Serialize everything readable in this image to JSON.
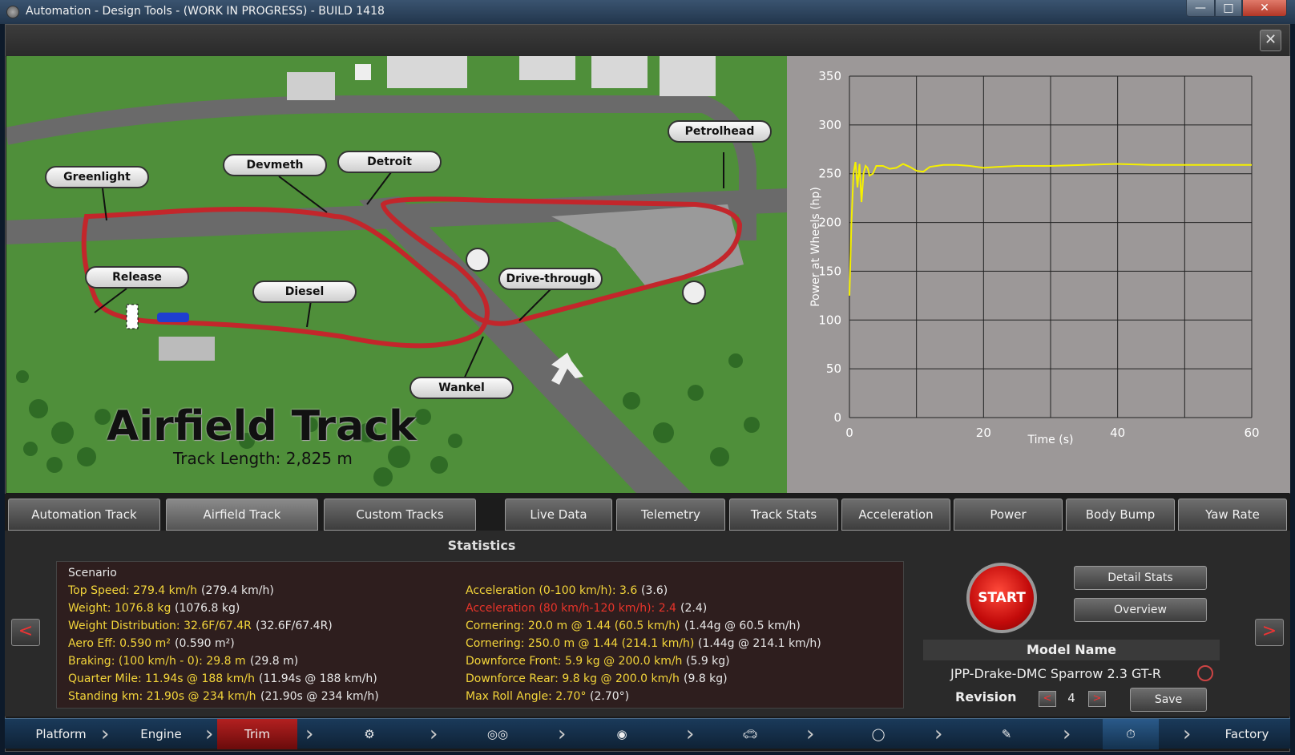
{
  "window": {
    "title": "Automation - Design Tools - (WORK IN PROGRESS) - BUILD 1418"
  },
  "map": {
    "title": "Airfield Track",
    "length": "Track Length: 2,825 m",
    "labels": {
      "greenlight": "Greenlight",
      "devmeth": "Devmeth",
      "detroit": "Detroit",
      "petrolhead": "Petrolhead",
      "release": "Release",
      "diesel": "Diesel",
      "drive_through": "Drive-through",
      "wankel": "Wankel"
    }
  },
  "chart_data": {
    "type": "line",
    "xlabel": "Time (s)",
    "ylabel": "Power at Wheels (hp)",
    "xlim": [
      0,
      60
    ],
    "ylim": [
      0,
      350
    ],
    "xticks": [
      "0",
      "20",
      "40",
      "60"
    ],
    "yticks": [
      "0",
      "50",
      "100",
      "150",
      "200",
      "250",
      "300",
      "350"
    ],
    "line_color": "#f5f000",
    "grid": true,
    "x": [
      0,
      0.3,
      0.6,
      0.9,
      1.2,
      1.5,
      1.8,
      2.1,
      2.4,
      2.7,
      3.0,
      3.5,
      4,
      5,
      6,
      7,
      8,
      9,
      10,
      11,
      12,
      14,
      16,
      18,
      20,
      22,
      25,
      30,
      35,
      40,
      45,
      50,
      55,
      60
    ],
    "y": [
      125,
      200,
      250,
      262,
      236,
      260,
      221,
      250,
      258,
      256,
      248,
      250,
      258,
      258,
      255,
      256,
      260,
      257,
      253,
      252,
      257,
      259,
      259,
      258,
      256,
      257,
      258,
      258,
      259,
      260,
      259,
      259,
      259,
      259
    ]
  },
  "tabs": {
    "automation_track": "Automation Track",
    "airfield_track": "Airfield Track",
    "custom_tracks": "Custom Tracks",
    "live_data": "Live Data",
    "telemetry": "Telemetry",
    "track_stats": "Track Stats",
    "acceleration": "Acceleration",
    "power": "Power",
    "body_bump": "Body Bump",
    "yaw_rate": "Yaw Rate"
  },
  "stats": {
    "header": "Statistics",
    "scenario": "Scenario",
    "left": [
      {
        "label": "Top Speed: 279.4 km/h",
        "value": "(279.4 km/h)"
      },
      {
        "label": "Weight: 1076.8 kg",
        "value": "(1076.8 kg)"
      },
      {
        "label": "Weight Distribution: 32.6F/67.4R",
        "value": "(32.6F/67.4R)"
      },
      {
        "label": "Aero Eff: 0.590 m²",
        "value": "(0.590 m²)"
      },
      {
        "label": "Braking: (100 km/h - 0): 29.8 m",
        "value": "(29.8 m)"
      },
      {
        "label": "Quarter Mile: 11.94s @ 188 km/h",
        "value": "(11.94s @ 188 km/h)"
      },
      {
        "label": "Standing km: 21.90s @ 234 km/h",
        "value": "(21.90s @ 234 km/h)"
      }
    ],
    "right": [
      {
        "label": "Acceleration (0-100 km/h): 3.6",
        "value": "(3.6)"
      },
      {
        "label": "Acceleration (80 km/h-120 km/h): 2.4",
        "value": "(2.4)"
      },
      {
        "label": "Cornering: 20.0 m @ 1.44 (60.5 km/h)",
        "value": "(1.44g @ 60.5 km/h)"
      },
      {
        "label": "Cornering: 250.0 m @ 1.44 (214.1 km/h)",
        "value": "(1.44g @ 214.1 km/h)"
      },
      {
        "label": "Downforce Front: 5.9 kg @ 200.0 km/h",
        "value": "(5.9 kg)"
      },
      {
        "label": "Downforce Rear: 9.8 kg @ 200.0 km/h",
        "value": "(9.8 kg)"
      },
      {
        "label": "Max Roll Angle: 2.70°",
        "value": "(2.70°)"
      }
    ]
  },
  "controls": {
    "start": "START",
    "detail_stats": "Detail Stats",
    "overview": "Overview",
    "model_name_label": "Model Name",
    "model_name": "JPP-Drake-DMC Sparrow 2.3  GT-R",
    "revision_label": "Revision",
    "revision": "4",
    "save": "Save",
    "prev": "<",
    "next": ">"
  },
  "bottom_nav": {
    "platform": "Platform",
    "engine": "Engine",
    "trim": "Trim",
    "factory": "Factory"
  }
}
